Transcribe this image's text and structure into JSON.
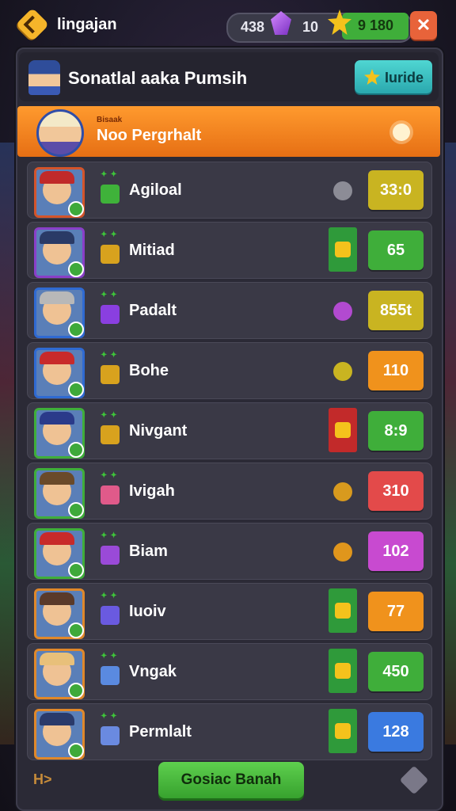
{
  "topbar": {
    "title": "lingajan",
    "currency_left": "438",
    "currency_mid": "10",
    "currency_green": "9 180",
    "close_label": "✕"
  },
  "header": {
    "title": "Sonatlal aaka Pumsih",
    "invite_label": "Iuride"
  },
  "my_row": {
    "label": "Bisaak",
    "name": "Noo Pergrhalt"
  },
  "rows": [
    {
      "name": "Agiloal",
      "score": "33:0",
      "score_color": "#c9b421",
      "frame": "#d4542a",
      "hat": "#c02a2a",
      "item": "#3fb23a",
      "mid": "icon",
      "mid_color": "#8c8c96"
    },
    {
      "name": "Mitiad",
      "score": "65",
      "score_color": "#3fae3a",
      "frame": "#8a3fc8",
      "hat": "#2a3a66",
      "item": "#d8a21e",
      "mid": "card",
      "mid_color": "#2f9a3a"
    },
    {
      "name": "Padalt",
      "score": "855t",
      "score_color": "#c9b421",
      "frame": "#2f6ad2",
      "hat": "#b8b8b8",
      "item": "#8a3fe0",
      "mid": "icon",
      "mid_color": "#b24ad0"
    },
    {
      "name": "Bohe",
      "score": "110",
      "score_color": "#f0921c",
      "frame": "#2f6ad2",
      "hat": "#c82a2a",
      "item": "#d8a21e",
      "mid": "icon",
      "mid_color": "#c9b421"
    },
    {
      "name": "Nivgant",
      "score": "8:9",
      "score_color": "#3fae3a",
      "frame": "#3fae3a",
      "hat": "#2a3a8a",
      "item": "#d8a21e",
      "mid": "card",
      "mid_color": "#c22a2a"
    },
    {
      "name": "Ivigah",
      "score": "310",
      "score_color": "#e34a4a",
      "frame": "#3fae3a",
      "hat": "#6a4a2a",
      "item": "#e05a8a",
      "mid": "icon",
      "mid_color": "#d89a1e"
    },
    {
      "name": "Biam",
      "score": "102",
      "score_color": "#c84ad0",
      "frame": "#3fae3a",
      "hat": "#c82a2a",
      "item": "#9a4ad8",
      "mid": "icon",
      "mid_color": "#e0961c"
    },
    {
      "name": "Iuoiv",
      "score": "77",
      "score_color": "#f0921c",
      "frame": "#e0882a",
      "hat": "#5a3a2a",
      "item": "#6a5ae0",
      "mid": "card",
      "mid_color": "#2f9a3a"
    },
    {
      "name": "Vngak",
      "score": "450",
      "score_color": "#3fae3a",
      "frame": "#e0882a",
      "hat": "#e8c07a",
      "item": "#5a8ae0",
      "mid": "card",
      "mid_color": "#2f9a3a"
    },
    {
      "name": "Permlalt",
      "score": "128",
      "score_color": "#3a7ae0",
      "frame": "#e0882a",
      "hat": "#2a3a6a",
      "item": "#6a8ae0",
      "mid": "card",
      "mid_color": "#2f9a3a"
    }
  ],
  "footer": {
    "left_label": "H>",
    "button_label": "Gosiac Banah"
  },
  "icons": {
    "back": "back-icon",
    "gem": "gem-icon",
    "star": "star-icon",
    "gear": "gear-icon",
    "item": "item-icon"
  }
}
